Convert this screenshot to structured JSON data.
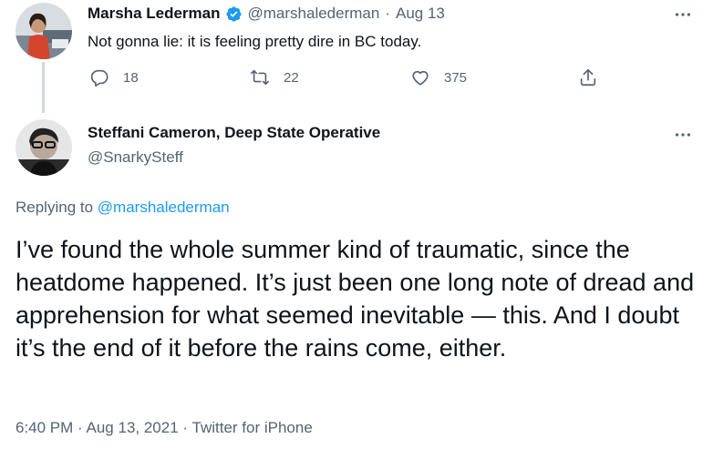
{
  "parent_tweet": {
    "author_name": "Marsha Lederman",
    "author_handle": "@marshalederman",
    "separator": "·",
    "date": "Aug 13",
    "text": "Not gonna lie: it is feeling pretty dire in BC today.",
    "verified": true,
    "stats": {
      "replies": "18",
      "retweets": "22",
      "likes": "375"
    }
  },
  "reply_tweet": {
    "author_name": "Steffani Cameron, Deep State Operative",
    "author_handle": "@SnarkySteff",
    "replying_prefix": "Replying to",
    "replying_to": "@marshalederman",
    "text": "I’ve found the whole summer kind of traumatic, since the heatdome happened. It’s just been one long note of dread and apprehension for what seemed inevitable — this. And I doubt it’s the end of it before the rains come, either.",
    "time": "6:40 PM",
    "separator1": "·",
    "full_date": "Aug 13, 2021",
    "separator2": "·",
    "source": "Twitter for iPhone"
  },
  "colors": {
    "text": "#0f1419",
    "secondary": "#536471",
    "link": "#1d9bf0",
    "thread_line": "#cfd9de"
  },
  "icons": {
    "reply": "speech-bubble-icon",
    "retweet": "retweet-arrows-icon",
    "like": "heart-icon",
    "share": "share-upload-icon",
    "more": "more-dots-icon",
    "verified": "verified-badge-icon"
  }
}
